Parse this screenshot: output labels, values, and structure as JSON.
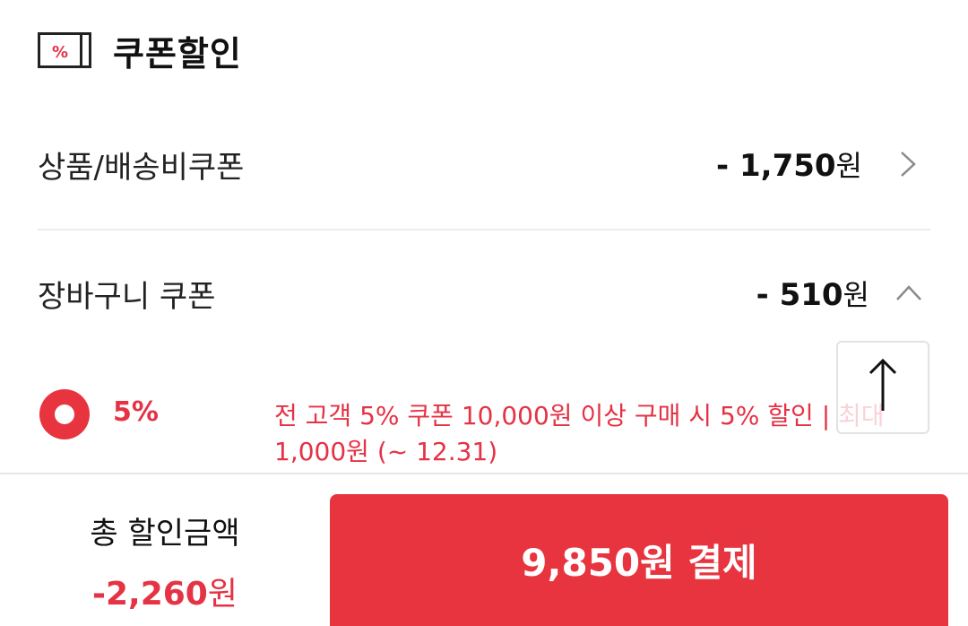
{
  "section": {
    "title": "쿠폰할인",
    "icon": "coupon-ticket-icon"
  },
  "rows": {
    "product_shipping": {
      "label": "상품/배송비쿠폰",
      "amount": "- 1,750",
      "unit": "원",
      "icon": "chevron-right-icon"
    },
    "cart": {
      "label": "장바구니 쿠폰",
      "amount": "- 510",
      "unit": "원",
      "icon": "chevron-up-icon"
    }
  },
  "cart_coupon": {
    "selected": true,
    "rate": "5%",
    "description": "전 고객 5% 쿠폰 10,000원 이상 구매 시 5% 할인 | 최대 1,000원 (~ 12.31)"
  },
  "scroll_top": {
    "icon": "arrow-up-icon"
  },
  "summary": {
    "total_label": "총 할인금액",
    "total_amount": "-2,260",
    "total_unit": "원"
  },
  "pay_button": {
    "label": "9,850원 결제"
  },
  "colors": {
    "accent": "#e8343f",
    "accent_text": "#e53244",
    "divider": "#ececec"
  }
}
